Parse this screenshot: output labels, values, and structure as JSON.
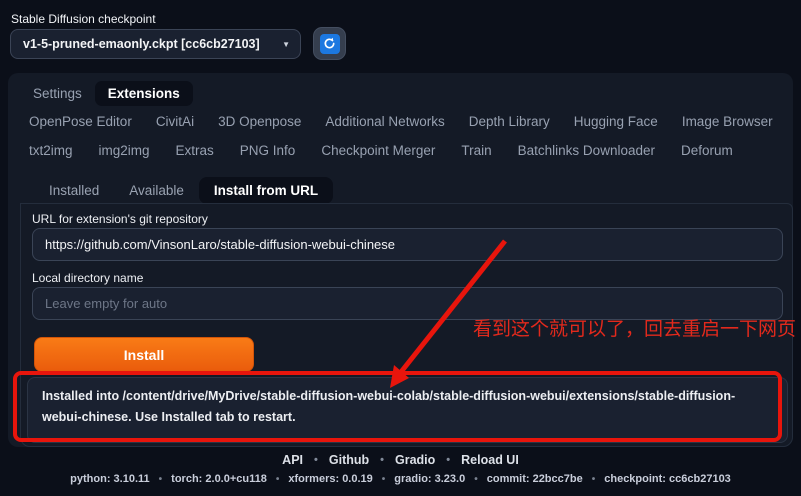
{
  "header": {
    "checkpoint_label": "Stable Diffusion checkpoint",
    "checkpoint_value": "v1-5-pruned-emaonly.ckpt [cc6cb27103]",
    "caret": "▼"
  },
  "tabs": {
    "row1": [
      "Settings",
      "Extensions"
    ],
    "row2": [
      "OpenPose Editor",
      "CivitAi",
      "3D Openpose",
      "Additional Networks",
      "Depth Library",
      "Hugging Face",
      "Image Browser"
    ],
    "row3": [
      "txt2img",
      "img2img",
      "Extras",
      "PNG Info",
      "Checkpoint Merger",
      "Train",
      "Batchlinks Downloader",
      "Deforum"
    ],
    "active_tab": "Extensions"
  },
  "subtabs": {
    "items": [
      "Installed",
      "Available",
      "Install from URL"
    ],
    "active_subtab": "Install from URL"
  },
  "form": {
    "url_label": "URL for extension's git repository",
    "url_value": "https://github.com/VinsonLaro/stable-diffusion-webui-chinese",
    "dir_label": "Local directory name",
    "dir_placeholder": "Leave empty for auto",
    "install_button": "Install",
    "result_message": "Installed into /content/drive/MyDrive/stable-diffusion-webui-colab/stable-diffusion-webui/extensions/stable-diffusion-webui-chinese. Use Installed tab to restart."
  },
  "annotations": {
    "note_text": "看到这个就可以了，回去重启一下网页",
    "red_color": "#e8150c"
  },
  "footer": {
    "links": [
      "API",
      "Github",
      "Gradio",
      "Reload UI"
    ],
    "separator": "•",
    "versions": [
      "python: 3.10.11",
      "torch: 2.0.0+cu118",
      "xformers: 0.0.19",
      "gradio: 3.23.0",
      "commit: 22bcc7be",
      "checkpoint: cc6cb27103"
    ]
  },
  "colors": {
    "accent_orange": "#ea5c0c",
    "refresh_blue": "#1c78e0",
    "page_bg": "#0b0f19",
    "panel_bg": "#141a26"
  }
}
